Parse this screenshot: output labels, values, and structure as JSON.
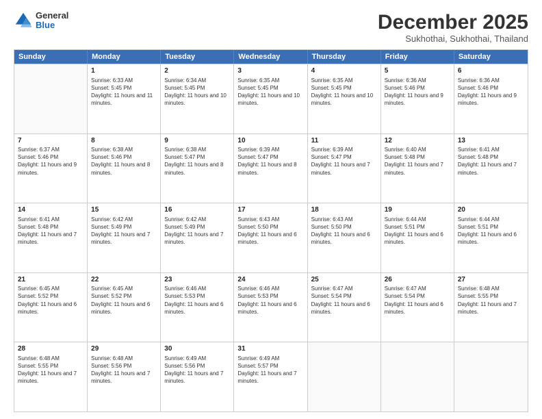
{
  "header": {
    "logo": {
      "general": "General",
      "blue": "Blue"
    },
    "title": "December 2025",
    "subtitle": "Sukhothai, Sukhothai, Thailand"
  },
  "calendar": {
    "days": [
      "Sunday",
      "Monday",
      "Tuesday",
      "Wednesday",
      "Thursday",
      "Friday",
      "Saturday"
    ],
    "rows": [
      [
        {
          "day": "",
          "empty": true
        },
        {
          "day": "1",
          "rise": "6:33 AM",
          "set": "5:45 PM",
          "daylight": "11 hours and 11 minutes."
        },
        {
          "day": "2",
          "rise": "6:34 AM",
          "set": "5:45 PM",
          "daylight": "11 hours and 10 minutes."
        },
        {
          "day": "3",
          "rise": "6:35 AM",
          "set": "5:45 PM",
          "daylight": "11 hours and 10 minutes."
        },
        {
          "day": "4",
          "rise": "6:35 AM",
          "set": "5:45 PM",
          "daylight": "11 hours and 10 minutes."
        },
        {
          "day": "5",
          "rise": "6:36 AM",
          "set": "5:46 PM",
          "daylight": "11 hours and 9 minutes."
        },
        {
          "day": "6",
          "rise": "6:36 AM",
          "set": "5:46 PM",
          "daylight": "11 hours and 9 minutes."
        }
      ],
      [
        {
          "day": "7",
          "rise": "6:37 AM",
          "set": "5:46 PM",
          "daylight": "11 hours and 9 minutes."
        },
        {
          "day": "8",
          "rise": "6:38 AM",
          "set": "5:46 PM",
          "daylight": "11 hours and 8 minutes."
        },
        {
          "day": "9",
          "rise": "6:38 AM",
          "set": "5:47 PM",
          "daylight": "11 hours and 8 minutes."
        },
        {
          "day": "10",
          "rise": "6:39 AM",
          "set": "5:47 PM",
          "daylight": "11 hours and 8 minutes."
        },
        {
          "day": "11",
          "rise": "6:39 AM",
          "set": "5:47 PM",
          "daylight": "11 hours and 7 minutes."
        },
        {
          "day": "12",
          "rise": "6:40 AM",
          "set": "5:48 PM",
          "daylight": "11 hours and 7 minutes."
        },
        {
          "day": "13",
          "rise": "6:41 AM",
          "set": "5:48 PM",
          "daylight": "11 hours and 7 minutes."
        }
      ],
      [
        {
          "day": "14",
          "rise": "6:41 AM",
          "set": "5:48 PM",
          "daylight": "11 hours and 7 minutes."
        },
        {
          "day": "15",
          "rise": "6:42 AM",
          "set": "5:49 PM",
          "daylight": "11 hours and 7 minutes."
        },
        {
          "day": "16",
          "rise": "6:42 AM",
          "set": "5:49 PM",
          "daylight": "11 hours and 7 minutes."
        },
        {
          "day": "17",
          "rise": "6:43 AM",
          "set": "5:50 PM",
          "daylight": "11 hours and 6 minutes."
        },
        {
          "day": "18",
          "rise": "6:43 AM",
          "set": "5:50 PM",
          "daylight": "11 hours and 6 minutes."
        },
        {
          "day": "19",
          "rise": "6:44 AM",
          "set": "5:51 PM",
          "daylight": "11 hours and 6 minutes."
        },
        {
          "day": "20",
          "rise": "6:44 AM",
          "set": "5:51 PM",
          "daylight": "11 hours and 6 minutes."
        }
      ],
      [
        {
          "day": "21",
          "rise": "6:45 AM",
          "set": "5:52 PM",
          "daylight": "11 hours and 6 minutes."
        },
        {
          "day": "22",
          "rise": "6:45 AM",
          "set": "5:52 PM",
          "daylight": "11 hours and 6 minutes."
        },
        {
          "day": "23",
          "rise": "6:46 AM",
          "set": "5:53 PM",
          "daylight": "11 hours and 6 minutes."
        },
        {
          "day": "24",
          "rise": "6:46 AM",
          "set": "5:53 PM",
          "daylight": "11 hours and 6 minutes."
        },
        {
          "day": "25",
          "rise": "6:47 AM",
          "set": "5:54 PM",
          "daylight": "11 hours and 6 minutes."
        },
        {
          "day": "26",
          "rise": "6:47 AM",
          "set": "5:54 PM",
          "daylight": "11 hours and 6 minutes."
        },
        {
          "day": "27",
          "rise": "6:48 AM",
          "set": "5:55 PM",
          "daylight": "11 hours and 7 minutes."
        }
      ],
      [
        {
          "day": "28",
          "rise": "6:48 AM",
          "set": "5:55 PM",
          "daylight": "11 hours and 7 minutes."
        },
        {
          "day": "29",
          "rise": "6:48 AM",
          "set": "5:56 PM",
          "daylight": "11 hours and 7 minutes."
        },
        {
          "day": "30",
          "rise": "6:49 AM",
          "set": "5:56 PM",
          "daylight": "11 hours and 7 minutes."
        },
        {
          "day": "31",
          "rise": "6:49 AM",
          "set": "5:57 PM",
          "daylight": "11 hours and 7 minutes."
        },
        {
          "day": "",
          "empty": true
        },
        {
          "day": "",
          "empty": true
        },
        {
          "day": "",
          "empty": true
        }
      ]
    ]
  }
}
